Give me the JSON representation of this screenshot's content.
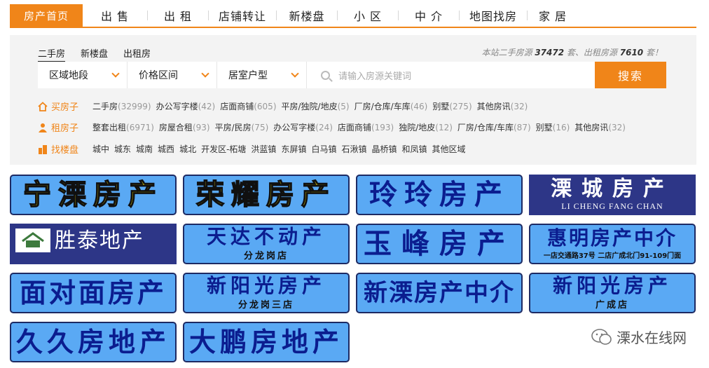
{
  "topnav": {
    "items": [
      {
        "label": "房产首页",
        "active": true
      },
      {
        "label": "出 售"
      },
      {
        "label": "出 租"
      },
      {
        "label": "店铺转让"
      },
      {
        "label": "新楼盘"
      },
      {
        "label": "小 区"
      },
      {
        "label": "中 介"
      },
      {
        "label": "地图找房"
      },
      {
        "label": "家 居"
      }
    ]
  },
  "search": {
    "tabs": [
      "二手房",
      "新楼盘",
      "出租房"
    ],
    "stats": {
      "prefix": "本站二手房源",
      "resale_count": "37472",
      "middle": "套、出租房源",
      "rent_count": "7610",
      "suffix": "套！"
    },
    "dropdowns": [
      "区域地段",
      "价格区间",
      "居室户型"
    ],
    "placeholder": "请输入房源关键词",
    "button": "搜索"
  },
  "rows": [
    {
      "label": "买房子",
      "icon": "home-icon",
      "links": [
        {
          "t": "二手房",
          "c": "(32999)"
        },
        {
          "t": "办公写字楼",
          "c": "(42)"
        },
        {
          "t": "店面商铺",
          "c": "(605)"
        },
        {
          "t": "平房/独院/地皮",
          "c": "(5)"
        },
        {
          "t": "厂房/仓库/车库",
          "c": "(46)"
        },
        {
          "t": "别墅",
          "c": "(275)"
        },
        {
          "t": "其他房讯",
          "c": "(32)"
        }
      ]
    },
    {
      "label": "租房子",
      "icon": "person-icon",
      "links": [
        {
          "t": "整套出租",
          "c": "(6971)"
        },
        {
          "t": "房屋合租",
          "c": "(93)"
        },
        {
          "t": "平房/民房",
          "c": "(75)"
        },
        {
          "t": "办公写字楼",
          "c": "(24)"
        },
        {
          "t": "店面商铺",
          "c": "(193)"
        },
        {
          "t": "独院/地皮",
          "c": "(12)"
        },
        {
          "t": "厂房/仓库/车库",
          "c": "(87)"
        },
        {
          "t": "别墅",
          "c": "(16)"
        },
        {
          "t": "其他房讯",
          "c": "(32)"
        }
      ]
    },
    {
      "label": "找楼盘",
      "icon": "building-icon",
      "links": [
        {
          "t": "城中",
          "c": ""
        },
        {
          "t": "城东",
          "c": ""
        },
        {
          "t": "城南",
          "c": ""
        },
        {
          "t": "城西",
          "c": ""
        },
        {
          "t": "城北",
          "c": ""
        },
        {
          "t": "开发区-柘塘",
          "c": ""
        },
        {
          "t": "洪蓝镇",
          "c": ""
        },
        {
          "t": "东屏镇",
          "c": ""
        },
        {
          "t": "白马镇",
          "c": ""
        },
        {
          "t": "石湫镇",
          "c": ""
        },
        {
          "t": "晶桥镇",
          "c": ""
        },
        {
          "t": "和凤镇",
          "c": ""
        },
        {
          "t": "其他区域",
          "c": ""
        }
      ]
    }
  ],
  "agencies": {
    "ningli": "宁溧房产",
    "rongyao": "荣耀房产",
    "lingling": "玲玲房产",
    "licheng": "溧城房产",
    "licheng_en": "LI CHENG FANG CHAN",
    "shengtai": "胜泰地产",
    "tianda": "天达不动产",
    "tianda_sub": "分龙岗店",
    "yufeng": "玉峰房产",
    "huiming": "惠明房产中介",
    "huiming_sub": "一店交通路37号 二店广成北门91-109门面",
    "mianduimian": "面对面房产",
    "xinyang1": "新阳光房产",
    "xinyang1_sub": "分龙岗三店",
    "xinli": "新溧房产中介",
    "xinyang2": "新阳光房产",
    "xinyang2_sub": "广成店",
    "jiujiu": "久久房地产",
    "dapeng": "大鹏房地产"
  },
  "watermark": "溧水在线网",
  "colors": {
    "accent": "#f08519",
    "logo_bg": "#5aa9f4",
    "logo_text": "#0b1d8f"
  }
}
